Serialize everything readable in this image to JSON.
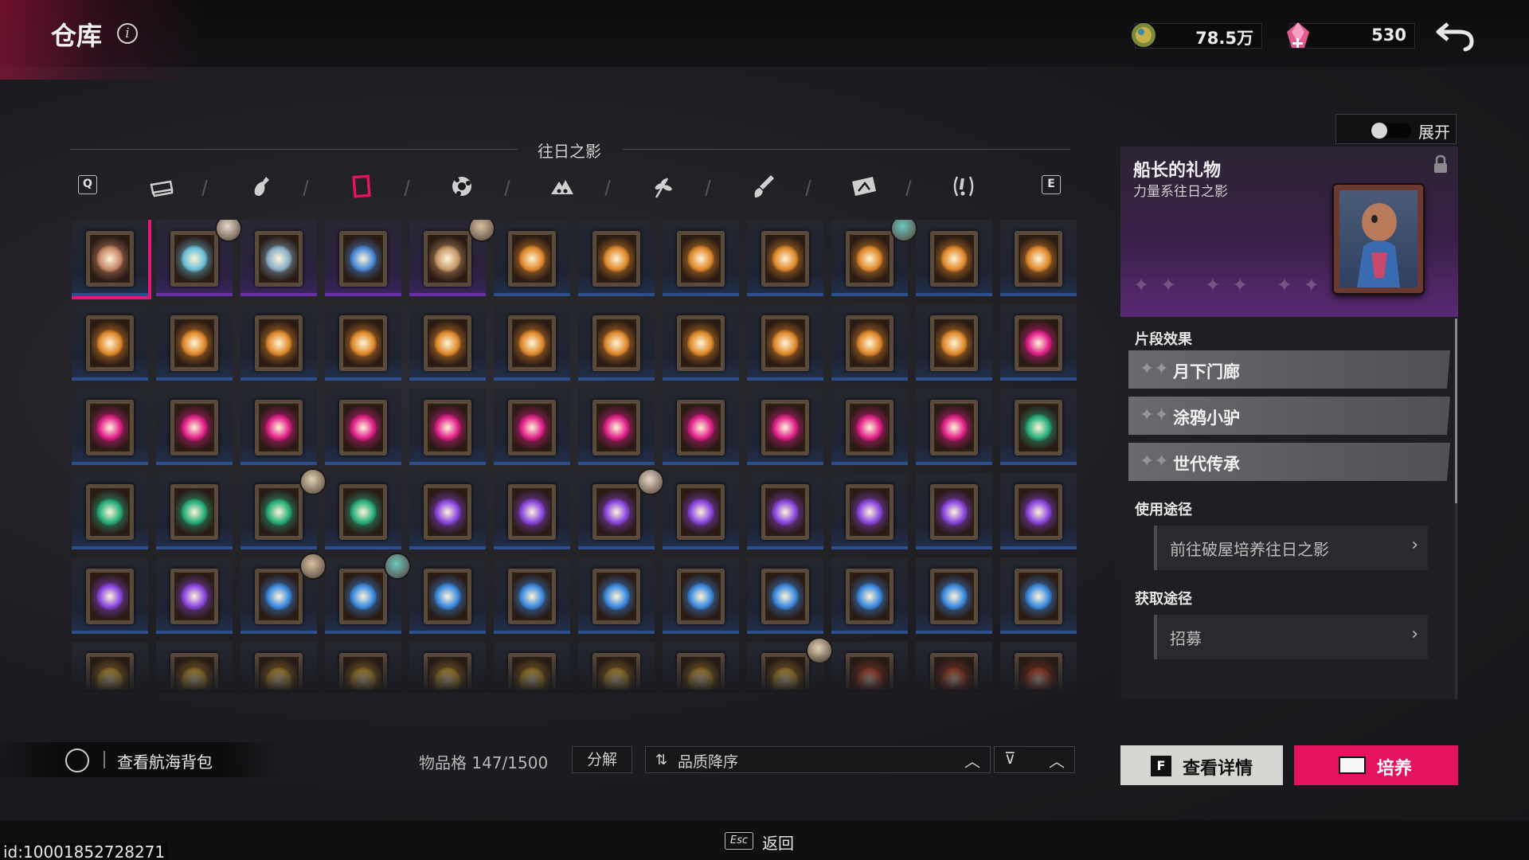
{
  "header": {
    "title": "仓库",
    "coin_value": "78.5万",
    "gem_value": "530"
  },
  "category": {
    "title": "往日之影",
    "key_left": "Q",
    "key_right": "E",
    "tabs": [
      "chest-icon",
      "bottle-icon",
      "frame-icon",
      "pinwheel-icon",
      "mountain-icon",
      "sprig-icon",
      "brush-icon",
      "card-icon",
      "alert-icon"
    ],
    "active_tab": 2
  },
  "grid": {
    "rows": [
      [
        "portrait",
        "crystal",
        "knight",
        "orb",
        "book",
        "fire",
        "fire",
        "fire",
        "fire",
        "fire",
        "fire",
        "fire"
      ],
      [
        "fire",
        "fire",
        "fire",
        "fire",
        "fire",
        "fire",
        "fire",
        "fire",
        "fire",
        "fire",
        "fire",
        "lips"
      ],
      [
        "lips",
        "lips",
        "lips",
        "lips",
        "lips",
        "lips",
        "lips",
        "lips",
        "lips",
        "lips",
        "lips",
        "boot"
      ],
      [
        "boot",
        "boot",
        "boot",
        "boot",
        "burst",
        "burst",
        "burst",
        "burst",
        "burst",
        "burst",
        "burst",
        "burst"
      ],
      [
        "burst",
        "burst",
        "flower",
        "flower",
        "flower",
        "flower",
        "flower",
        "flower",
        "flower",
        "flower",
        "flower",
        "flower"
      ],
      [
        "chest",
        "chest",
        "chest",
        "chest",
        "chest",
        "chest",
        "chest",
        "chest",
        "chest",
        "red",
        "red",
        "red"
      ]
    ],
    "selected": [
      0,
      0
    ],
    "purple_cells": [
      [
        0,
        1
      ],
      [
        0,
        2
      ],
      [
        0,
        3
      ],
      [
        0,
        4
      ]
    ],
    "avatars": [
      [
        0,
        1
      ],
      [
        0,
        4
      ],
      [
        0,
        9
      ],
      [
        3,
        2
      ],
      [
        3,
        6
      ],
      [
        4,
        2
      ],
      [
        4,
        3
      ],
      [
        5,
        8
      ]
    ]
  },
  "footer": {
    "bag_label": "查看航海背包",
    "slots_text": "物品格 147/1500",
    "decompose_label": "分解",
    "sort_label": "品质降序",
    "esc_key": "Esc",
    "esc_label": "返回",
    "id_text": "id:10001852728271"
  },
  "detail": {
    "toggle_label": "展开",
    "name": "船长的礼物",
    "subtitle": "力量系往日之影",
    "effects_title": "片段效果",
    "effects": [
      "月下门廊",
      "涂鸦小驴",
      "世代传承"
    ],
    "usage_title": "使用途径",
    "usage_link": "前往破屋培养往日之影",
    "source_title": "获取途径",
    "source_link": "招募",
    "details_key": "F",
    "details_label": "查看详情",
    "train_label": "培养"
  },
  "colors": {
    "accent": "#e5135f",
    "fire": "#e08a2c",
    "lips": "#e0208a",
    "boot": "#28b07a",
    "burst": "#8a46e0",
    "flower": "#3a8ae0",
    "chest": "#d8a630",
    "red": "#c84a2a"
  }
}
